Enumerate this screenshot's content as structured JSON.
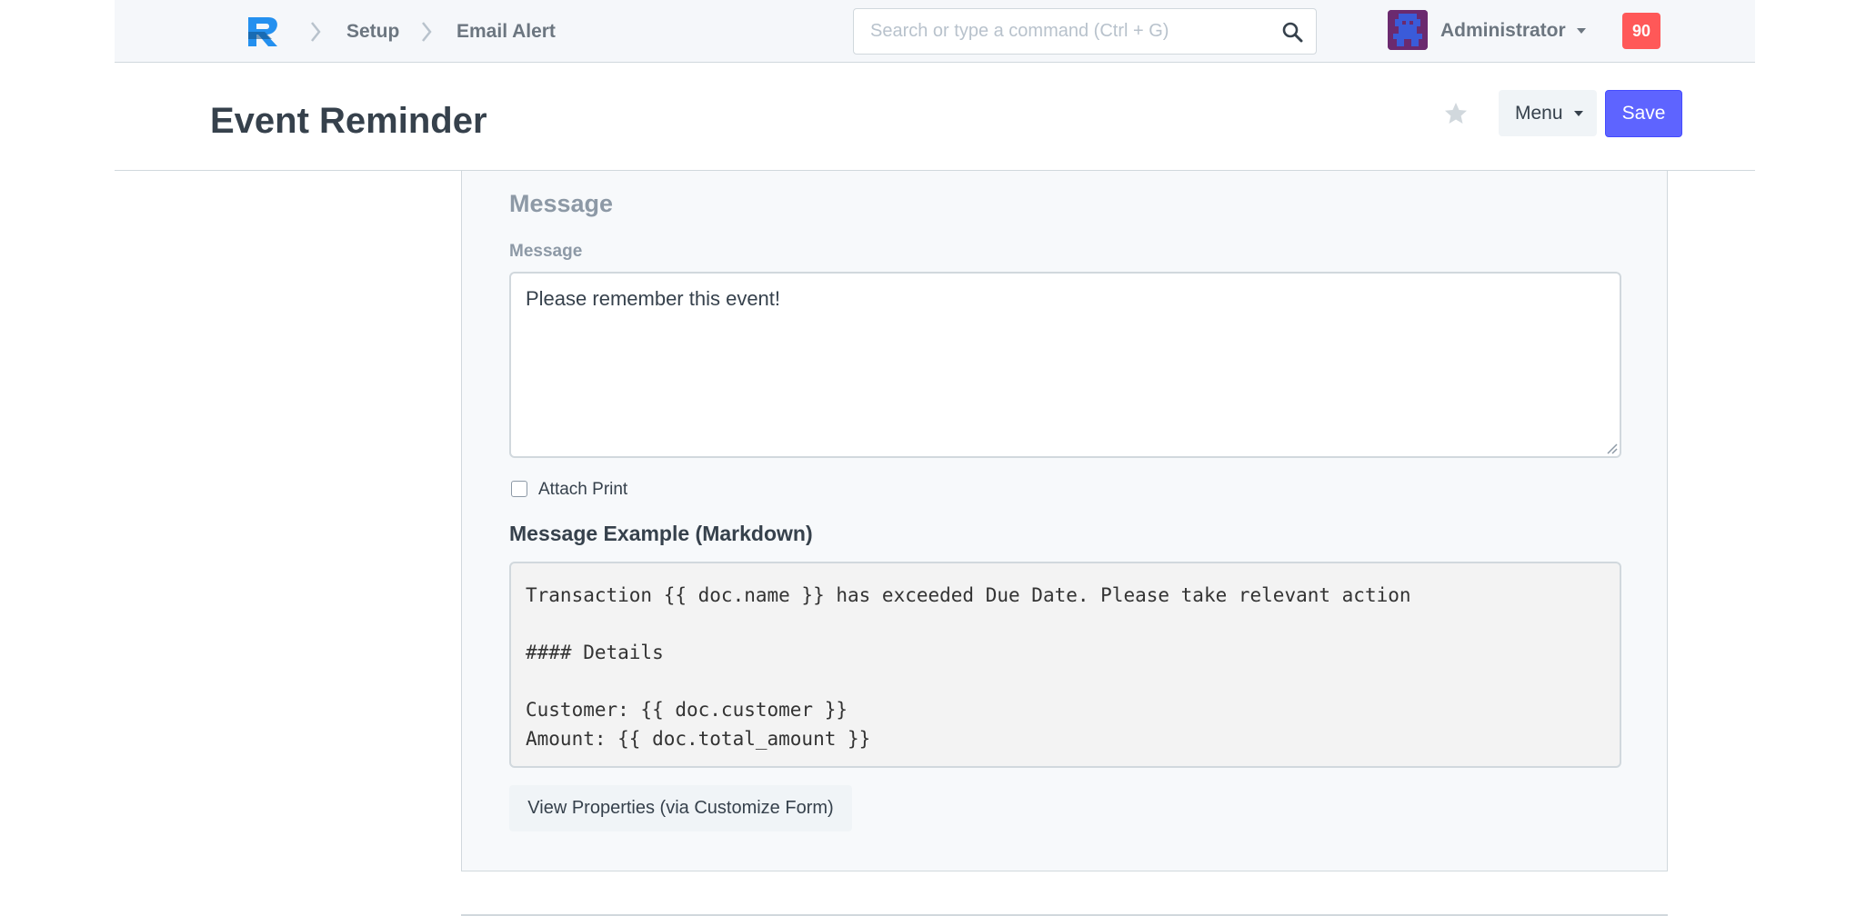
{
  "breadcrumbs": {
    "items": [
      "Setup",
      "Email Alert"
    ]
  },
  "search": {
    "placeholder": "Search or type a command (Ctrl + G)",
    "icon": "search-icon"
  },
  "user": {
    "name": "Administrator",
    "notification_count": "90"
  },
  "page": {
    "title": "Event Reminder",
    "menu_label": "Menu",
    "save_label": "Save"
  },
  "form": {
    "section_heading": "Message",
    "message_label": "Message",
    "message_value": "Please remember this event!",
    "attach_print_label": "Attach Print",
    "attach_print_checked": false,
    "example_heading": "Message Example (Markdown)",
    "example_code": "Transaction {{ doc.name }} has exceeded Due Date. Please take relevant action\n\n#### Details\n\nCustomer: {{ doc.customer }}\nAmount: {{ doc.total_amount }}",
    "view_properties_label": "View Properties (via Customize Form)"
  },
  "colors": {
    "primary": "#5e64ff",
    "notification": "#ff5858",
    "navbar_bg": "#f5f7fa"
  }
}
